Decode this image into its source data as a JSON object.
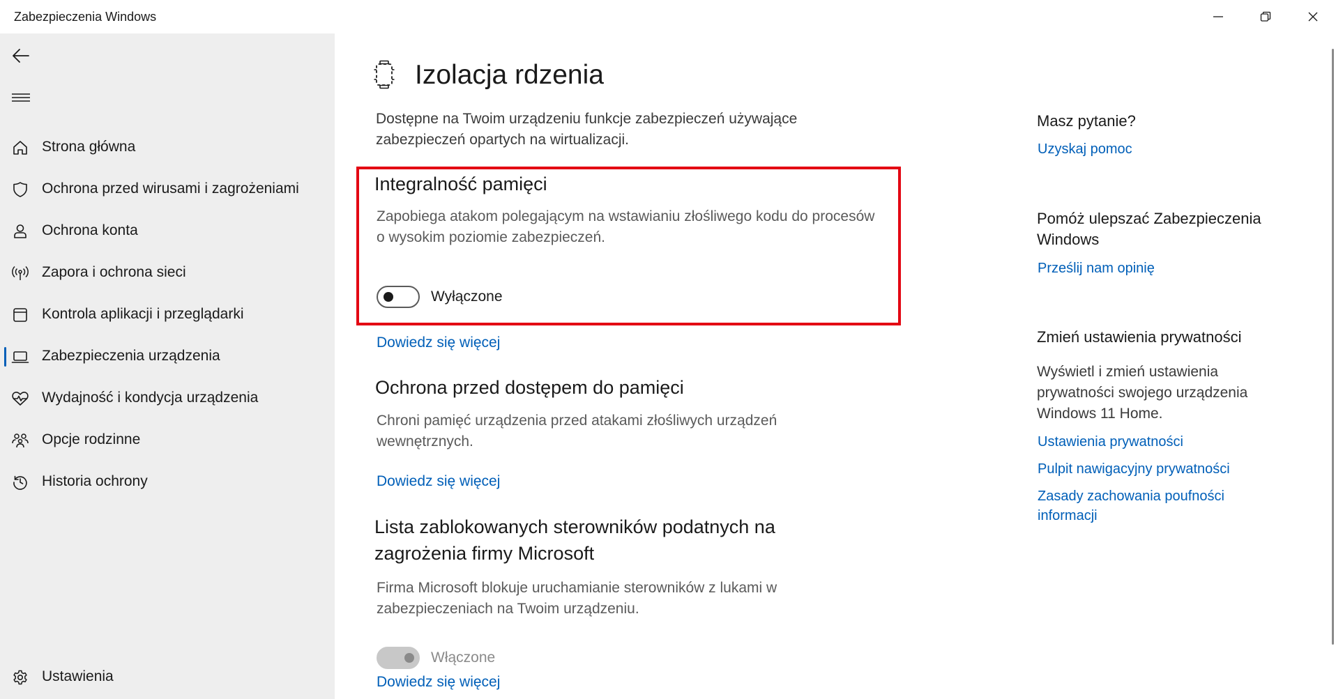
{
  "window": {
    "title": "Zabezpieczenia Windows",
    "controls": [
      "minimize-icon",
      "restore-icon",
      "close-icon"
    ]
  },
  "sidebar": {
    "back_icon": "back-arrow-icon",
    "menu_icon": "hamburger-menu-icon",
    "items": [
      {
        "label": "Strona główna",
        "icon": "home-icon"
      },
      {
        "label": "Ochrona przed wirusami i zagrożeniami",
        "icon": "shield-icon"
      },
      {
        "label": "Ochrona konta",
        "icon": "person-icon"
      },
      {
        "label": "Zapora i ochrona sieci",
        "icon": "antenna-icon"
      },
      {
        "label": "Kontrola aplikacji i przeglądarki",
        "icon": "app-window-icon"
      },
      {
        "label": "Zabezpieczenia urządzenia",
        "icon": "laptop-icon",
        "active": true
      },
      {
        "label": "Wydajność i kondycja urządzenia",
        "icon": "heartbeat-icon"
      },
      {
        "label": "Opcje rodzinne",
        "icon": "family-icon"
      },
      {
        "label": "Historia ochrony",
        "icon": "history-icon"
      }
    ],
    "settings": {
      "label": "Ustawienia",
      "icon": "gear-icon"
    }
  },
  "main": {
    "title": "Izolacja rdzenia",
    "title_icon": "core-isolation-chip-icon",
    "description": "Dostępne na Twoim urządzeniu funkcje zabezpieczeń używające zabezpieczeń opartych na wirtualizacji.",
    "sections": [
      {
        "title": "Integralność pamięci",
        "description": "Zapobiega atakom polegającym na wstawianiu złośliwego kodu do procesów o wysokim poziomie zabezpieczeń.",
        "toggle_state": "Wyłączone",
        "toggle_on": false,
        "link": "Dowiedz się więcej"
      },
      {
        "title": "Ochrona przed dostępem do pamięci",
        "description": "Chroni pamięć urządzenia przed atakami złośliwych urządzeń wewnętrznych.",
        "link": "Dowiedz się więcej"
      },
      {
        "title": "Lista zablokowanych sterowników podatnych na zagrożenia firmy Microsoft",
        "description": "Firma Microsoft blokuje uruchamianie sterowników z lukami w zabezpieczeniach na Twoim urządzeniu.",
        "toggle_state": "Włączone",
        "toggle_on": true,
        "toggle_disabled": true,
        "link": "Dowiedz się więcej"
      }
    ],
    "highlight_color": "#e30613",
    "link_color": "#005fb8"
  },
  "right_pane": {
    "question": {
      "heading": "Masz pytanie?",
      "link": "Uzyskaj pomoc"
    },
    "feedback": {
      "heading": "Pomóż ulepszać Zabezpieczenia Windows",
      "link": "Prześlij nam opinię"
    },
    "privacy": {
      "heading": "Zmień ustawienia prywatności",
      "text": "Wyświetl i zmień ustawienia prywatności swojego urządzenia Windows 11 Home.",
      "links": [
        "Ustawienia prywatności",
        "Pulpit nawigacyjny prywatności",
        "Zasady zachowania poufności informacji"
      ]
    }
  }
}
